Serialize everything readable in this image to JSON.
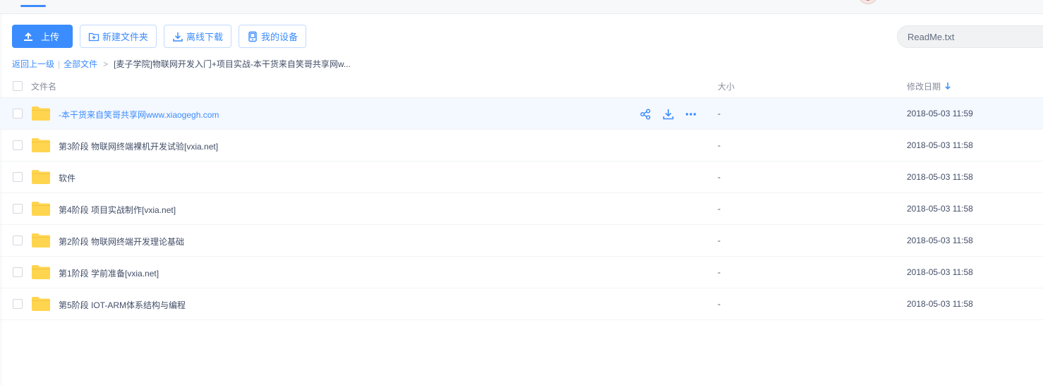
{
  "toolbar": {
    "upload_label": "上传",
    "new_folder_label": "新建文件夹",
    "offline_download_label": "离线下载",
    "my_devices_label": "我的设备"
  },
  "search": {
    "value": "ReadMe.txt"
  },
  "breadcrumb": {
    "back_label": "返回上一级",
    "all_files_label": "全部文件",
    "separator": "|",
    "arrow": ">",
    "current": "[麦子学院]物联网开发入门+项目实战-本干货来自笑哥共享网w..."
  },
  "columns": {
    "name": "文件名",
    "size": "大小",
    "date": "修改日期"
  },
  "files": [
    {
      "name": "-本干货来自笑哥共享网www.xiaogegh.com",
      "size": "-",
      "date": "2018-05-03 11:59"
    },
    {
      "name": "第3阶段 物联网终端裸机开发试验[vxia.net]",
      "size": "-",
      "date": "2018-05-03 11:58"
    },
    {
      "name": "软件",
      "size": "-",
      "date": "2018-05-03 11:58"
    },
    {
      "name": "第4阶段 项目实战制作[vxia.net]",
      "size": "-",
      "date": "2018-05-03 11:58"
    },
    {
      "name": "第2阶段 物联网终端开发理论基础",
      "size": "-",
      "date": "2018-05-03 11:58"
    },
    {
      "name": "第1阶段 学前准备[vxia.net]",
      "size": "-",
      "date": "2018-05-03 11:58"
    },
    {
      "name": "第5阶段 IOT-ARM体系结构与编程",
      "size": "-",
      "date": "2018-05-03 11:58"
    }
  ],
  "colors": {
    "accent": "#3b8cff",
    "folder": "#ffd54f",
    "hover_row": "#f4f8ff"
  }
}
